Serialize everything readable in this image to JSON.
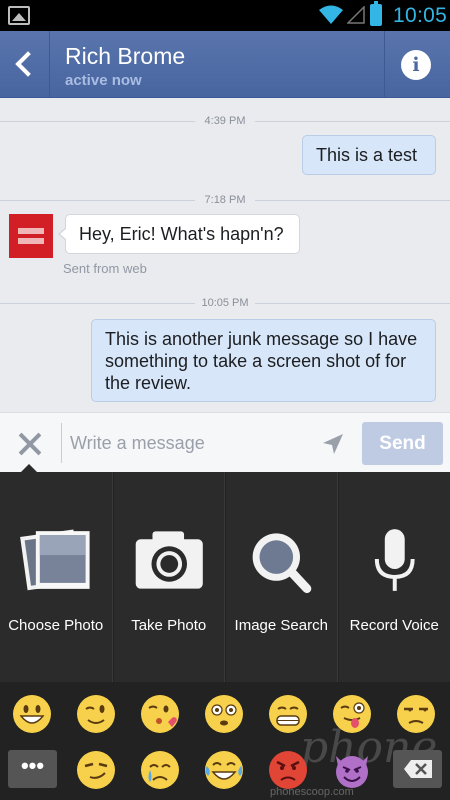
{
  "status_bar": {
    "time": "10:05"
  },
  "header": {
    "name": "Rich Brome",
    "status": "active now"
  },
  "messages": {
    "divider1": "4:39 PM",
    "msg1": "This is a test",
    "divider2": "7:18 PM",
    "msg2": "Hey, Eric! What's hapn'n?",
    "msg2_source": "Sent from web",
    "divider3": "10:05 PM",
    "msg3": "This is another junk message so I have something to take a screen shot of for the review."
  },
  "composer": {
    "placeholder": "Write a message",
    "send_label": "Send"
  },
  "tray": {
    "choose_photo": "Choose Photo",
    "take_photo": "Take Photo",
    "image_search": "Image Search",
    "record_voice": "Record Voice"
  },
  "emoji": {
    "more_label": "•••",
    "row1": [
      "grinning-face",
      "winking-face",
      "face-throwing-kiss",
      "flushed-face",
      "grimacing-face",
      "winking-tongue-face",
      "unamused-face"
    ],
    "row2": [
      "smirking-face",
      "crying-face",
      "tears-of-joy-face",
      "angry-red-face",
      "smiling-devil-face"
    ]
  },
  "watermark": {
    "brand": "phone",
    "url": "phonescoop.com"
  },
  "colors": {
    "header": "#4e69a2",
    "status_accent": "#33b5e5",
    "outgoing_bubble": "#d7e6f8",
    "send_button": "#bfcbe3"
  }
}
